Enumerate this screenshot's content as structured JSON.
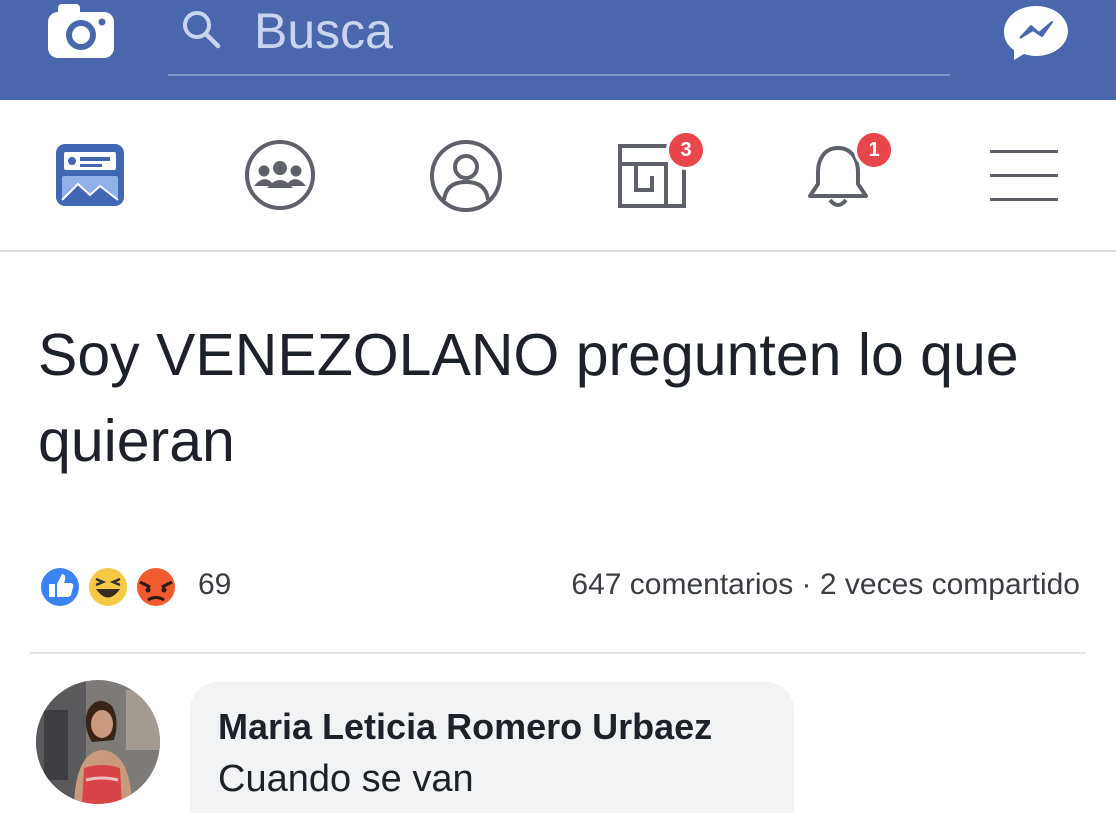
{
  "header": {
    "search_placeholder": "Busca",
    "icons": [
      "camera-icon",
      "search-icon",
      "messenger-icon"
    ]
  },
  "nav": {
    "items": [
      {
        "name": "news-feed",
        "icon": "news-feed-icon",
        "active": true
      },
      {
        "name": "groups",
        "icon": "groups-icon"
      },
      {
        "name": "profile",
        "icon": "profile-icon"
      },
      {
        "name": "marketplace",
        "icon": "marketplace-icon",
        "badge": "3"
      },
      {
        "name": "notifications",
        "icon": "bell-icon",
        "badge": "1"
      },
      {
        "name": "menu",
        "icon": "hamburger-menu-icon"
      }
    ]
  },
  "post": {
    "text": "Soy VENEZOLANO pregunten lo que quieran",
    "reactions": [
      "like-icon",
      "haha-icon",
      "angry-icon"
    ],
    "reaction_count": "69",
    "stats": "647 comentarios · 2 veces compartido"
  },
  "comment": {
    "author": "Maria Leticia Romero Urbaez",
    "text": "Cuando se van"
  },
  "colors": {
    "header_blue": "#4a67ad",
    "active_nav_blue": "#4267b2",
    "badge_red": "#e8464a",
    "text_dark": "#1d2129"
  }
}
